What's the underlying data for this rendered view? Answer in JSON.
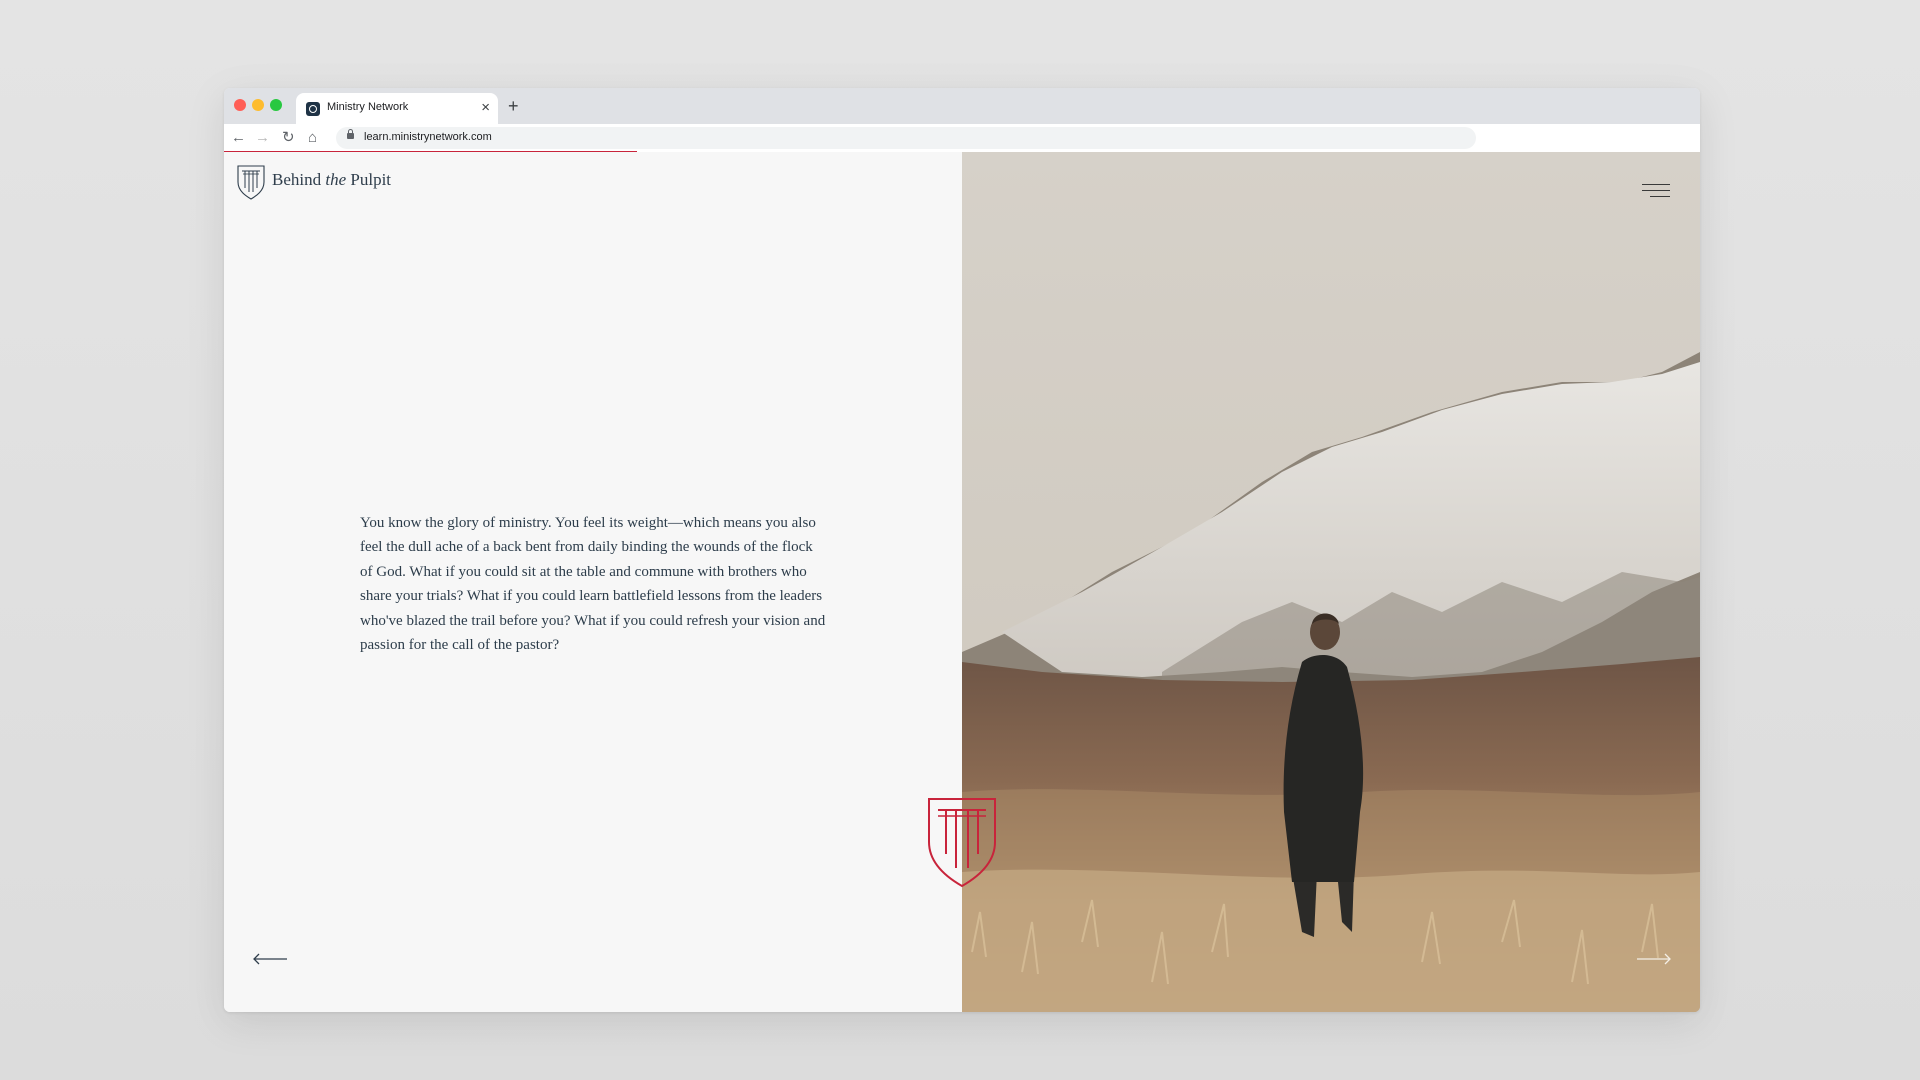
{
  "browser": {
    "tab_title": "Ministry Network",
    "tab_close": "×",
    "new_tab": "+",
    "url": "learn.ministrynetwork.com",
    "back": "←",
    "forward": "→",
    "reload": "↻",
    "home": "⌂",
    "load_progress_percent": 28
  },
  "site": {
    "logo": {
      "pre": "Behind ",
      "italic": "the",
      "post": " Pulpit"
    },
    "intro_text": "You know the glory of ministry. You feel its weight—which means you also feel the dull ache of a back bent from daily binding the wounds of the flock of God. What if you could sit at the table and commune with brothers who share your trials? What if you could learn battlefield lessons from the leaders who've blazed the trail before you? What if you could refresh your vision and passion for the call of the pastor?",
    "accent_color": "#c8243b",
    "text_color": "#2d3d4b"
  },
  "icons": {
    "menu": "hamburger-icon",
    "prev": "arrow-left-icon",
    "next": "arrow-right-icon",
    "emblem": "pulpit-shield-icon"
  }
}
